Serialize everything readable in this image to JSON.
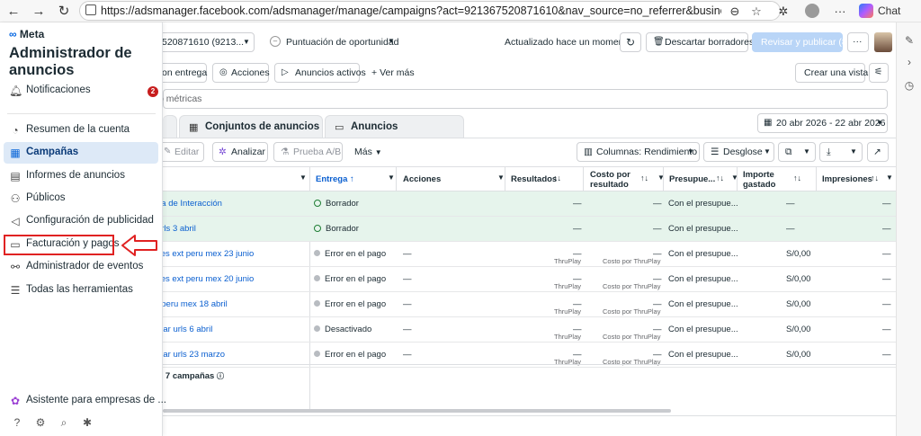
{
  "browser": {
    "url": "https://adsmanager.facebook.com/adsmanager/manage/campaigns?act=921367520871610&nav_source=no_referrer&business_id=566...",
    "chat_label": "Chat"
  },
  "sidebar": {
    "logo": "Meta",
    "title": "Administrador de anuncios",
    "notifications": {
      "label": "Notificaciones",
      "badge": "2"
    },
    "items": [
      {
        "label": "Resumen de la cuenta",
        "icon": "gauge-icon"
      },
      {
        "label": "Campañas",
        "icon": "table-icon",
        "active": true
      },
      {
        "label": "Informes de anuncios",
        "icon": "report-icon"
      },
      {
        "label": "Públicos",
        "icon": "people-icon"
      },
      {
        "label": "Configuración de publicidad",
        "icon": "megaphone-icon"
      },
      {
        "label": "Facturación y pagos",
        "icon": "card-icon",
        "highlighted": true
      },
      {
        "label": "Administrador de eventos",
        "icon": "events-icon"
      },
      {
        "label": "Todas las herramientas",
        "icon": "menu-icon"
      }
    ],
    "assistant": "Asistente para empresas de ..."
  },
  "header": {
    "account": "520871610 (9213...",
    "opportunity": "Puntuación de oportunidad",
    "updated": "Actualizado hace un momento",
    "discard": "Descartar borradores",
    "review": "Revisar y publicar (8)",
    "more": "···"
  },
  "filters": {
    "chip1": "on entrega",
    "chip2": "Acciones",
    "chip3": "Anuncios activos",
    "see_more": "Ver más",
    "create_view": "Crear una vista",
    "search_placeholder": "o métricas"
  },
  "tabs": {
    "adsets": "Conjuntos de anuncios",
    "ads": "Anuncios",
    "date_range": "20 abr 2026 - 22 abr 2026"
  },
  "toolbar": {
    "edit": "Editar",
    "analyze": "Analizar",
    "abtest": "Prueba A/B",
    "more": "Más",
    "columns": "Columnas: Rendimiento",
    "breakdown": "Desglose"
  },
  "table": {
    "headers": {
      "delivery": "Entrega ↑",
      "actions": "Acciones",
      "results": "Resultados",
      "cost": "Costo por resultado",
      "budget": "Presupue...",
      "spent": "Importe gastado",
      "impressions": "Impresiones"
    },
    "rows": [
      {
        "name": "ña de Interacción",
        "delivery": "Borrador",
        "status": "draft",
        "actions": "",
        "results": "—",
        "results_sub": "",
        "cost": "—",
        "cost_sub": "",
        "budget": "Con el presupue...",
        "spent": "—",
        "impressions": "—"
      },
      {
        "name": "urls 3 abril",
        "delivery": "Borrador",
        "status": "draft",
        "actions": "",
        "results": "—",
        "results_sub": "",
        "cost": "—",
        "cost_sub": "",
        "budget": "Con el presupue...",
        "spent": "—",
        "impressions": "—"
      },
      {
        "name": "ces ext peru mex 23 junio",
        "delivery": "Error en el pago",
        "status": "error",
        "actions": "—",
        "results": "—",
        "results_sub": "ThruPlay",
        "cost": "—",
        "cost_sub": "Costo por ThruPlay",
        "budget": "Con el presupue...",
        "spent": "S/0,00",
        "impressions": "—"
      },
      {
        "name": "ces ext peru mex 20 junio",
        "delivery": "Error en el pago",
        "status": "error",
        "actions": "—",
        "results": "—",
        "results_sub": "ThruPlay",
        "cost": "—",
        "cost_sub": "Costo por ThruPlay",
        "budget": "Con el presupue...",
        "spent": "S/0,00",
        "impressions": "—"
      },
      {
        "name": "t peru mex 18 abril",
        "delivery": "Error en el pago",
        "status": "error",
        "actions": "—",
        "results": "—",
        "results_sub": "ThruPlay",
        "cost": "—",
        "cost_sub": "Costo por ThruPlay",
        "budget": "Con el presupue...",
        "spent": "S/0,00",
        "impressions": "—"
      },
      {
        "name": "inar urls 6 abril",
        "delivery": "Desactivado",
        "status": "off",
        "actions": "—",
        "results": "—",
        "results_sub": "ThruPlay",
        "cost": "—",
        "cost_sub": "Costo por ThruPlay",
        "budget": "Con el presupue...",
        "spent": "S/0,00",
        "impressions": "—"
      },
      {
        "name": "inar urls 23 marzo",
        "delivery": "Error en el pago",
        "status": "error",
        "actions": "—",
        "results": "—",
        "results_sub": "ThruPlay",
        "cost": "—",
        "cost_sub": "Costo por ThruPlay",
        "budget": "Con el presupue...",
        "spent": "S/0,00",
        "impressions": "—"
      }
    ],
    "footer": "e 7 campañas"
  }
}
